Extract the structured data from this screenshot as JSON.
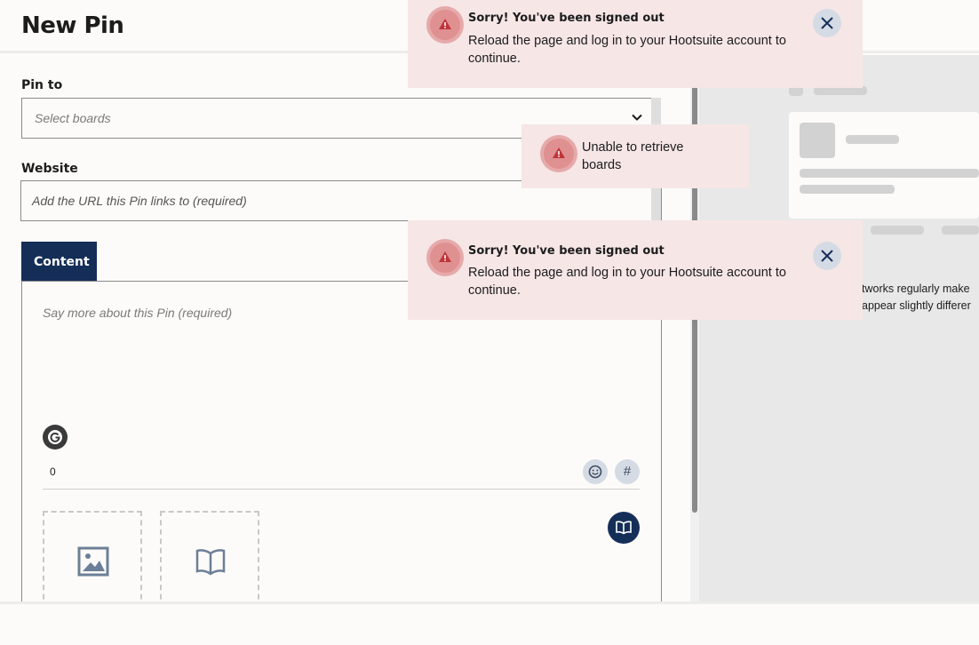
{
  "header": {
    "title": "New Pin"
  },
  "form": {
    "pin_to_label": "Pin to",
    "boards_placeholder": "Select boards",
    "website_label": "Website",
    "website_placeholder": "Add the URL this Pin links to (required)",
    "content_tab": "Content",
    "content_placeholder": "Say more about this Pin (required)",
    "char_count": "0",
    "hashtag_symbol": "#"
  },
  "preview": {
    "note_line1": "tworks regularly make",
    "note_line2": "appear slightly differer"
  },
  "toasts": [
    {
      "title": "Sorry! You've been signed out",
      "message": "Reload the page and log in to your Hootsuite account to continue."
    },
    {
      "message": "Unable to retrieve boards"
    },
    {
      "title": "Sorry! You've been signed out",
      "message": "Reload the page and log in to your Hootsuite account to continue."
    }
  ],
  "colors": {
    "primary": "#142e58",
    "toast_bg": "#f6e6e6",
    "error_icon": "#c0343a"
  }
}
